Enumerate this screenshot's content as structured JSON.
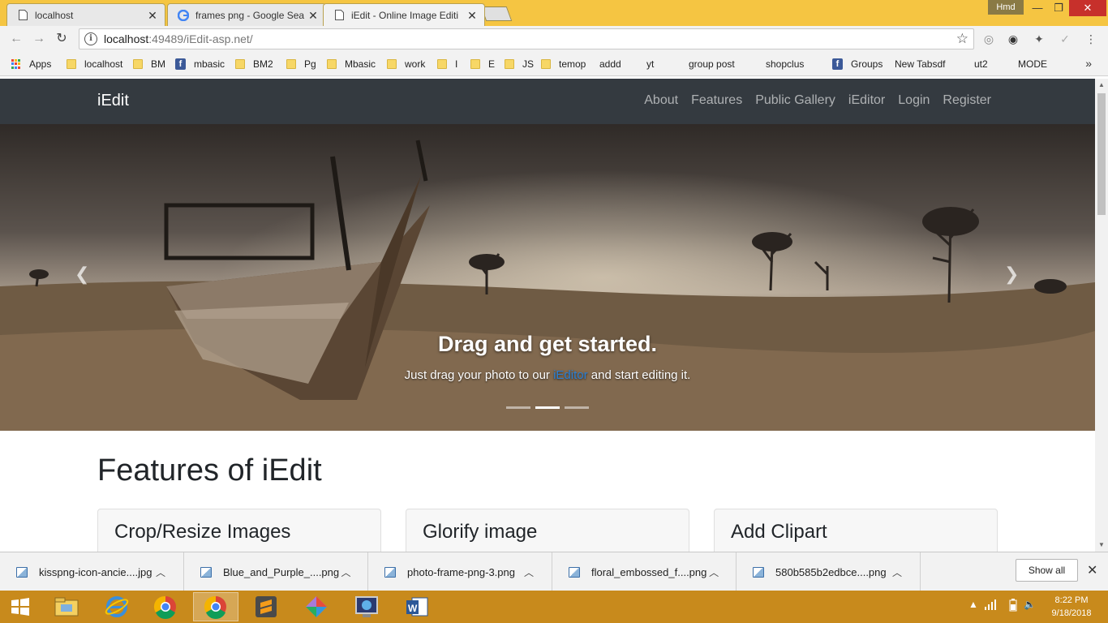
{
  "browser": {
    "tabs": [
      {
        "title": "localhost",
        "active": false
      },
      {
        "title": "frames png - Google Sea",
        "active": false
      },
      {
        "title": "iEdit - Online Image Editi",
        "active": true
      }
    ],
    "profile_name": "Hmd",
    "url_host": "localhost",
    "url_rest": ":49489/iEdit-asp.net/",
    "bookmarks": [
      {
        "label": "Apps",
        "icon": "apps"
      },
      {
        "label": "localhost",
        "icon": "folder"
      },
      {
        "label": "BM",
        "icon": "folder"
      },
      {
        "label": "mbasic",
        "icon": "facebook"
      },
      {
        "label": "BM2",
        "icon": "folder"
      },
      {
        "label": "Pg",
        "icon": "folder"
      },
      {
        "label": "Mbasic",
        "icon": "folder"
      },
      {
        "label": "work",
        "icon": "folder"
      },
      {
        "label": "I",
        "icon": "folder"
      },
      {
        "label": "E",
        "icon": "folder"
      },
      {
        "label": "JS",
        "icon": "folder"
      },
      {
        "label": "temop",
        "icon": "folder"
      },
      {
        "label": "addd",
        "icon": "page"
      },
      {
        "label": "yt",
        "icon": "page"
      },
      {
        "label": "group post",
        "icon": "page"
      },
      {
        "label": "shopclus",
        "icon": "page"
      },
      {
        "label": "Groups",
        "icon": "facebook"
      },
      {
        "label": "New Tabsdf",
        "icon": "page"
      },
      {
        "label": "ut2",
        "icon": "page"
      },
      {
        "label": "MODE",
        "icon": "page"
      }
    ],
    "bookmarks_more": "»"
  },
  "site": {
    "brand": "iEdit",
    "nav": [
      "About",
      "Features",
      "Public Gallery",
      "iEditor",
      "Login",
      "Register"
    ],
    "carousel": {
      "heading": "Drag and get started.",
      "text_before": "Just drag your photo to our ",
      "link": "iEditor",
      "text_after": " and start editing it.",
      "slide_count": 3,
      "active_slide": 2
    },
    "features_title": "Features of iEdit",
    "cards": [
      "Crop/Resize Images",
      "Glorify image",
      "Add Clipart"
    ]
  },
  "downloads": {
    "items": [
      "kisspng-icon-ancie....jpg",
      "Blue_and_Purple_....png",
      "photo-frame-png-3.png",
      "floral_embossed_f....png",
      "580b585b2edbce....png"
    ],
    "show_all": "Show all"
  },
  "taskbar": {
    "time": "8:22 PM",
    "date": "9/18/2018"
  }
}
